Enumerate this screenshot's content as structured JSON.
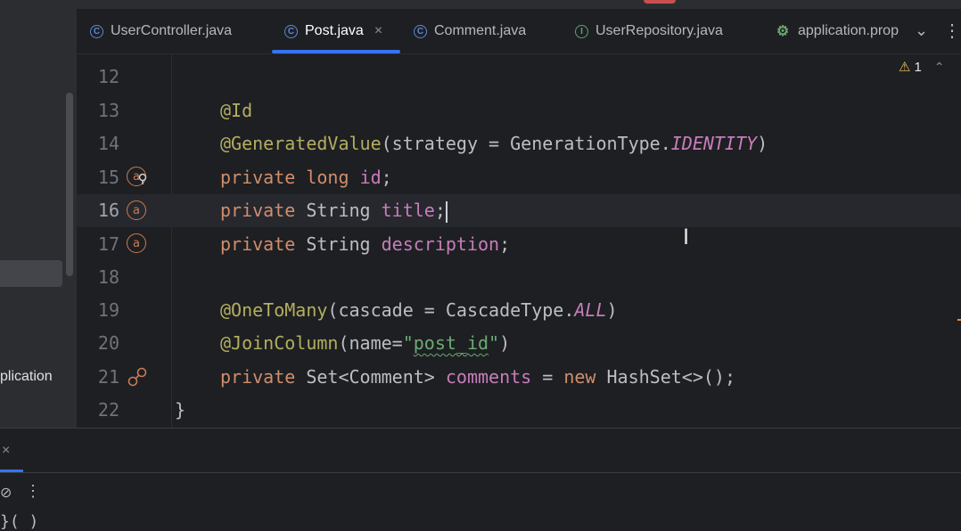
{
  "tabs": [
    {
      "label": "UserController.java",
      "icon": "class-icon",
      "glyph": "C"
    },
    {
      "label": "Post.java",
      "icon": "class-icon",
      "glyph": "C",
      "active": true,
      "close": "×"
    },
    {
      "label": "Comment.java",
      "icon": "class-icon",
      "glyph": "C"
    },
    {
      "label": "UserRepository.java",
      "icon": "interface-icon",
      "glyph": "I"
    },
    {
      "label": "application.prop",
      "icon": "properties-icon",
      "glyph": "⚙"
    }
  ],
  "tab_controls": {
    "chevron": "⌄",
    "more": "⋮"
  },
  "inspection": {
    "warning_icon": "⚠",
    "count": "1",
    "up": "⌃",
    "down": "⌄"
  },
  "sidebar": {
    "truncated_label": "plication"
  },
  "gutter": {
    "line_numbers": [
      "12",
      "13",
      "14",
      "15",
      "16",
      "17",
      "18",
      "19",
      "20",
      "21",
      "22"
    ],
    "icon_glyph": "a"
  },
  "code": {
    "l13_ann": "@Id",
    "l14_ann": "@GeneratedValue",
    "l14_a": "(strategy = GenerationType.",
    "l14_enum": "IDENTITY",
    "l14_b": ")",
    "l15_kw": "private",
    "l15_type": "long",
    "l15_field": "id",
    "l15_end": ";",
    "l16_kw": "private",
    "l16_type": " String ",
    "l16_field": "title",
    "l16_end": ";",
    "l17_kw": "private",
    "l17_type": " String ",
    "l17_field": "description",
    "l17_end": ";",
    "l19_ann": "@OneToMany",
    "l19_a": "(cascade = CascadeType.",
    "l19_enum": "ALL",
    "l19_b": ")",
    "l20_ann": "@JoinColumn",
    "l20_a": "(name=",
    "l20_str": "\"post_id\"",
    "l20_b": ")",
    "l21_kw": "private",
    "l21_type": " Set<Comment> ",
    "l21_field": "comments",
    "l21_mid": " = ",
    "l21_new": "new",
    "l21_rest": " HashSet<>();",
    "l22": "}"
  },
  "bottom_panel": {
    "close": "×",
    "tool_icon": "⊘",
    "more": "⋮",
    "peek": "}(      )"
  },
  "colors": {
    "accent": "#3574f0",
    "annotation": "#b3ae60",
    "keyword": "#cf8e6d",
    "field": "#c77dbb",
    "string": "#6aab73",
    "editor_bg": "#1e1f22"
  }
}
